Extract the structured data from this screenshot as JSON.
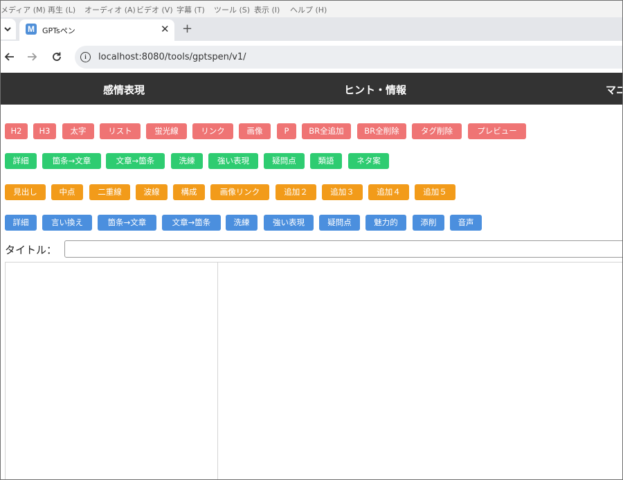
{
  "menu": [
    "メディア (M)",
    "再生 (L)",
    "オーディオ (A)",
    "ビデオ (V)",
    "字幕 (T)",
    "ツール (S)",
    "表示 (I)",
    "ヘルプ (H)"
  ],
  "browser": {
    "tab_title": "GPTsペン",
    "favicon_letter": "M",
    "url": "localhost:8080/tools/gptspen/v1/"
  },
  "nav": {
    "item1": "感情表現",
    "item2": "ヒント・情報",
    "item3": "マニ"
  },
  "row_red": [
    "H2",
    "H3",
    "太字",
    "リスト",
    "蛍光線",
    "リンク",
    "画像",
    "P",
    "BR全追加",
    "BR全削除",
    "タグ削除",
    "プレビュー"
  ],
  "row_green": [
    "詳細",
    "箇条→文章",
    "文章→箇条",
    "洗練",
    "強い表現",
    "疑問点",
    "類語",
    "ネタ案"
  ],
  "row_orange": [
    "見出し",
    "中点",
    "二重線",
    "波線",
    "構成",
    "画像リンク",
    "追加２",
    "追加３",
    "追加４",
    "追加５"
  ],
  "row_blue": [
    "詳細",
    "言い換え",
    "箇条→文章",
    "文章→箇条",
    "洗練",
    "強い表現",
    "疑問点",
    "魅力的",
    "添削",
    "音声"
  ],
  "title_label": "タイトル：",
  "colors": {
    "red": "#ef7474",
    "green": "#2ecc71",
    "orange": "#f29b1a",
    "blue": "#4b8fde",
    "nav_bg": "#333333"
  }
}
